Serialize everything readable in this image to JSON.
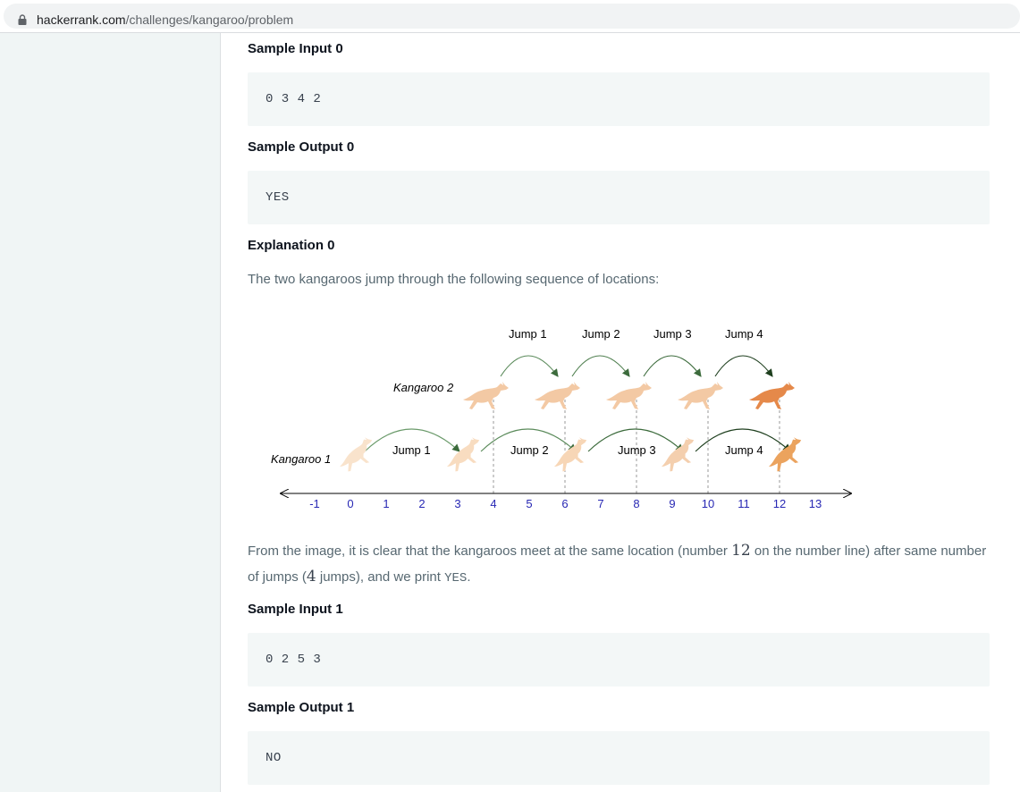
{
  "browser": {
    "url_domain": "hackerrank.com",
    "url_path": "/challenges/kangaroo/problem"
  },
  "problem": {
    "sample_input_0_heading": "Sample Input 0",
    "sample_input_0": "0 3 4 2",
    "sample_output_0_heading": "Sample Output 0",
    "sample_output_0": "YES",
    "explanation_0_heading": "Explanation 0",
    "explanation_intro": "The two kangaroos jump through the following sequence of locations:",
    "explanation_p1": "From the image, it is clear that the kangaroos meet at the same location (number ",
    "explanation_num1": "12",
    "explanation_p2": " on the number line) after same number of jumps (",
    "explanation_num2": "4",
    "explanation_p3": " jumps), and we print ",
    "explanation_code": "YES",
    "explanation_p4": ".",
    "sample_input_1_heading": "Sample Input 1",
    "sample_input_1": "0 2 5 3",
    "sample_output_1_heading": "Sample Output 1",
    "sample_output_1": "NO"
  },
  "diagram": {
    "kangaroo1_label": "Kangaroo 1",
    "kangaroo2_label": "Kangaroo 2",
    "k2_jumps": [
      "Jump 1",
      "Jump 2",
      "Jump 3",
      "Jump 4"
    ],
    "k1_jumps": [
      "Jump 1",
      "Jump 2",
      "Jump 3",
      "Jump 4"
    ],
    "ticks": [
      "-1",
      "0",
      "1",
      "2",
      "3",
      "4",
      "5",
      "6",
      "7",
      "8",
      "9",
      "10",
      "11",
      "12",
      "13"
    ],
    "tick_color": "#2828b4",
    "kangaroo_light": "#f6d2b0",
    "kangaroo_dark": "#e5894a",
    "arrow_color": "#3c6b3c"
  }
}
